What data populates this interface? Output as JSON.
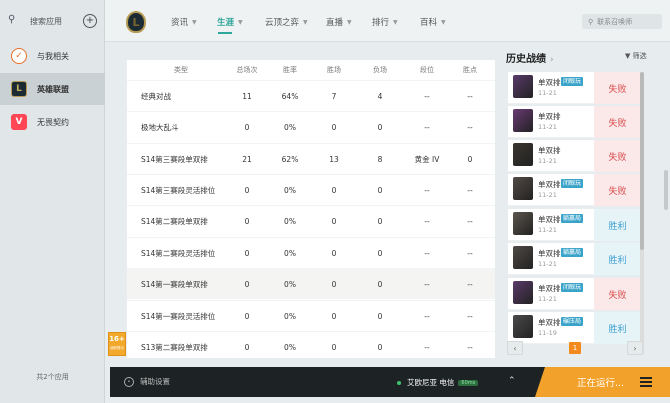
{
  "sidebar": {
    "search_label": "搜索应用",
    "items": [
      {
        "label": "与我相关",
        "icon": "related-icon"
      },
      {
        "label": "英雄联盟",
        "icon": "lol-icon"
      },
      {
        "label": "无畏契约",
        "icon": "valorant-icon"
      }
    ],
    "footer": "共2个应用"
  },
  "nav": {
    "items": [
      "资讯",
      "生涯",
      "云顶之弈",
      "直播",
      "排行",
      "百科"
    ],
    "active": "生涯",
    "search_placeholder": "联系召唤师"
  },
  "stats": {
    "columns": [
      "类型",
      "总场次",
      "胜率",
      "胜场",
      "负场",
      "段位",
      "胜点"
    ],
    "rows": [
      [
        "经典对战",
        "11",
        "64%",
        "7",
        "4",
        "--",
        "--"
      ],
      [
        "极地大乱斗",
        "0",
        "0%",
        "0",
        "0",
        "--",
        "--"
      ],
      [
        "S14第三赛段单双排",
        "21",
        "62%",
        "13",
        "8",
        "黄金 IV",
        "0"
      ],
      [
        "S14第三赛段灵活排位",
        "0",
        "0%",
        "0",
        "0",
        "--",
        "--"
      ],
      [
        "S14第二赛段单双排",
        "0",
        "0%",
        "0",
        "0",
        "--",
        "--"
      ],
      [
        "S14第二赛段灵活排位",
        "0",
        "0%",
        "0",
        "0",
        "--",
        "--"
      ],
      [
        "S14第一赛段单双排",
        "0",
        "0%",
        "0",
        "0",
        "--",
        "--"
      ],
      [
        "S14第一赛段灵活排位",
        "0",
        "0%",
        "0",
        "0",
        "--",
        "--"
      ],
      [
        "S13第二赛段单双排",
        "0",
        "0%",
        "0",
        "0",
        "--",
        "--"
      ]
    ]
  },
  "history": {
    "title": "历史战绩",
    "filter": "筛选",
    "items": [
      {
        "mode": "单双排",
        "tag": "闭眼玩",
        "date": "11-21",
        "result": "失败",
        "outcome": "lose",
        "tag_color": "#3aa3c9",
        "champ_color": "#5a3a6a"
      },
      {
        "mode": "单双排",
        "tag": "",
        "date": "11-21",
        "result": "失败",
        "outcome": "lose",
        "tag_color": "",
        "champ_color": "#6a3a75"
      },
      {
        "mode": "单双排",
        "tag": "",
        "date": "11-21",
        "result": "失败",
        "outcome": "lose",
        "tag_color": "",
        "champ_color": "#3a3530"
      },
      {
        "mode": "单双排",
        "tag": "闭眼玩",
        "date": "11-21",
        "result": "失败",
        "outcome": "lose",
        "tag_color": "#3aa3c9",
        "champ_color": "#524a44"
      },
      {
        "mode": "单双排",
        "tag": "躺赢局",
        "date": "11-21",
        "result": "胜利",
        "outcome": "win",
        "tag_color": "#3aa3c9",
        "champ_color": "#5c554d"
      },
      {
        "mode": "单双排",
        "tag": "躺赢局",
        "date": "11-21",
        "result": "胜利",
        "outcome": "win",
        "tag_color": "#3aa3c9",
        "champ_color": "#4e4944"
      },
      {
        "mode": "单双排",
        "tag": "闭眼玩",
        "date": "11-21",
        "result": "失败",
        "outcome": "lose",
        "tag_color": "#3aa3c9",
        "champ_color": "#5a3a6a"
      },
      {
        "mode": "单双排",
        "tag": "碾压局",
        "date": "11-19",
        "result": "胜利",
        "outcome": "win",
        "tag_color": "#3aa3c9",
        "champ_color": "#4a4a4a"
      }
    ],
    "page": "1"
  },
  "age_badge": {
    "rating": "16+",
    "caption": "适龄提示"
  },
  "bottombar": {
    "assist": "辅助设置",
    "server": "艾欧尼亚 电信",
    "ping": "60ms",
    "status": "正在运行..."
  },
  "colors": {
    "accent": "#2fa69a",
    "orange": "#f2a12a",
    "lose": "#d94a4a",
    "win": "#3d9fd0"
  }
}
